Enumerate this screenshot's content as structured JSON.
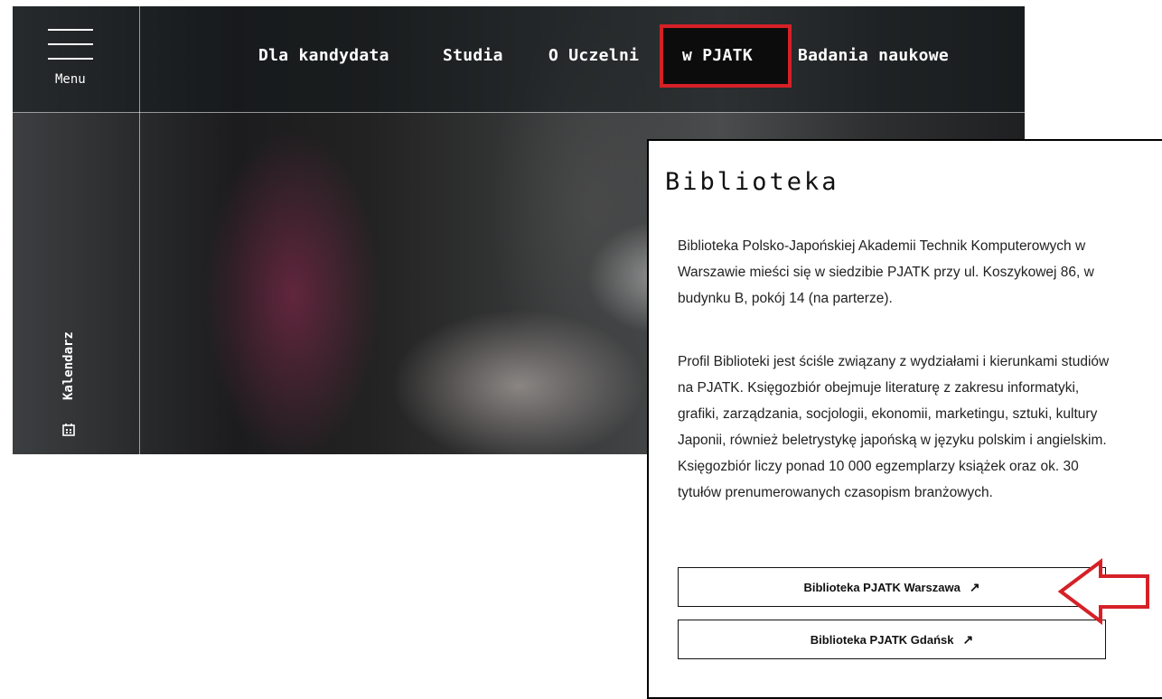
{
  "header": {
    "menu_label": "Menu",
    "nav_items": [
      "Dla kandydata",
      "Studia",
      "O Uczelni",
      "w PJATK",
      "Badania naukowe"
    ]
  },
  "sidebar": {
    "calendar_label": "Kalendarz",
    "calendar_icon": "calendar-icon"
  },
  "panel": {
    "title": "Biblioteka",
    "paragraph1": "Biblioteka Polsko-Japońskiej Akademii Technik Komputerowych w Warszawie mieści się w siedzibie PJATK przy ul. Koszykowej 86, w budynku B, pokój 14 (na parterze).",
    "paragraph2": "Profil Biblioteki jest ściśle związany z wydziałami i kierunkami studiów na PJATK. Księgozbiór obejmuje literaturę z zakresu informatyki, grafiki, zarządzania, socjologii, ekonomii, marketingu, sztuki, kultury Japonii, również beletrystykę japońską w języku polskim i angielskim. Księgozbiór liczy ponad 10 000 egzemplarzy książek oraz ok. 30 tytułów prenumerowanych czasopism branżowych.",
    "button1": "Biblioteka PJATK Warszawa",
    "button2": "Biblioteka PJATK Gdańsk",
    "button_icon": "external-arrow-icon"
  },
  "colors": {
    "highlight": "#d62027",
    "background": "#ffffff"
  }
}
